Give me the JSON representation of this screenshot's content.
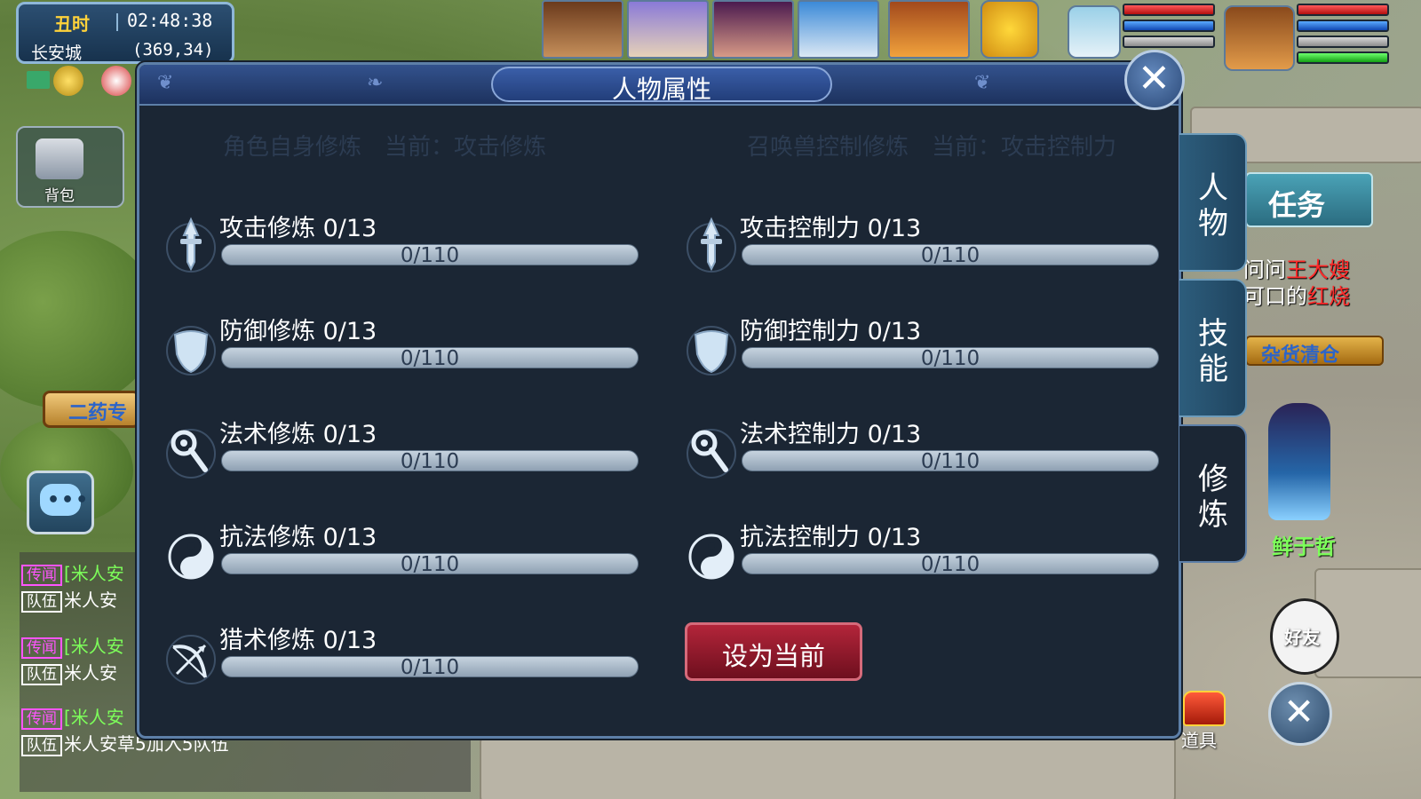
{
  "hud": {
    "time_cn": "丑时",
    "time": "02:48:38",
    "location": "长安城",
    "coordinates": "(369,34)",
    "bag_label": "背包",
    "npc_sign": "二药专"
  },
  "dialog": {
    "title": "人物属性",
    "left_section": "角色自身修炼　当前：攻击修炼",
    "right_section": "召唤兽控制修炼　当前：攻击控制力",
    "left_rows": [
      {
        "label": "攻击修炼 0/13",
        "bar": "0/110",
        "icon": "sword-icon",
        "progress": 0
      },
      {
        "label": "防御修炼 0/13",
        "bar": "0/110",
        "icon": "shield-icon",
        "progress": 0
      },
      {
        "label": "法术修炼 0/13",
        "bar": "0/110",
        "icon": "staff-icon",
        "progress": 0
      },
      {
        "label": "抗法修炼 0/13",
        "bar": "0/110",
        "icon": "yinyang-icon",
        "progress": 0
      },
      {
        "label": "猎术修炼 0/13",
        "bar": "0/110",
        "icon": "bow-icon",
        "progress": 0
      }
    ],
    "right_rows": [
      {
        "label": "攻击控制力 0/13",
        "bar": "0/110",
        "icon": "sword-icon",
        "progress": 0
      },
      {
        "label": "防御控制力 0/13",
        "bar": "0/110",
        "icon": "shield-icon",
        "progress": 0
      },
      {
        "label": "法术控制力 0/13",
        "bar": "0/110",
        "icon": "staff-icon",
        "progress": 0
      },
      {
        "label": "抗法控制力 0/13",
        "bar": "0/110",
        "icon": "yinyang-icon",
        "progress": 0
      }
    ],
    "set_current_label": "设为当前",
    "side_tabs": [
      {
        "label": "人\n物",
        "active": false
      },
      {
        "label": "技\n能",
        "active": false
      },
      {
        "label": "修\n炼",
        "active": true
      }
    ]
  },
  "right_panel": {
    "task_tab": "任务",
    "quest_line1_a": "问问",
    "quest_line1_b": "王大嫂",
    "quest_line2_a": "可口的",
    "quest_line2_b": "红烧",
    "shop_banner": "杂货清仓",
    "player_name": "鲜于哲",
    "friend_label": "好友",
    "item_label": "道具"
  },
  "chat": [
    {
      "tag": "传闻",
      "tag_type": "rumor",
      "text": "[米人安",
      "color": "green"
    },
    {
      "tag": "队伍",
      "tag_type": "team",
      "text": "米人安",
      "color": "white"
    },
    {
      "tag": "传闻",
      "tag_type": "rumor",
      "text": "[米人安",
      "color": "green"
    },
    {
      "tag": "队伍",
      "tag_type": "team",
      "text": "米人安",
      "color": "white"
    },
    {
      "tag": "传闻",
      "tag_type": "rumor",
      "text": "[米人安",
      "color": "green"
    },
    {
      "tag": "队伍",
      "tag_type": "team",
      "text": "米人安草5加入5队伍",
      "color": "white"
    }
  ],
  "colors": {
    "panel_bg": "#1b2634",
    "header": "#33528d",
    "button_red": "#b3253a",
    "hp": "#ff3a3a",
    "mp": "#1f6bdc"
  }
}
